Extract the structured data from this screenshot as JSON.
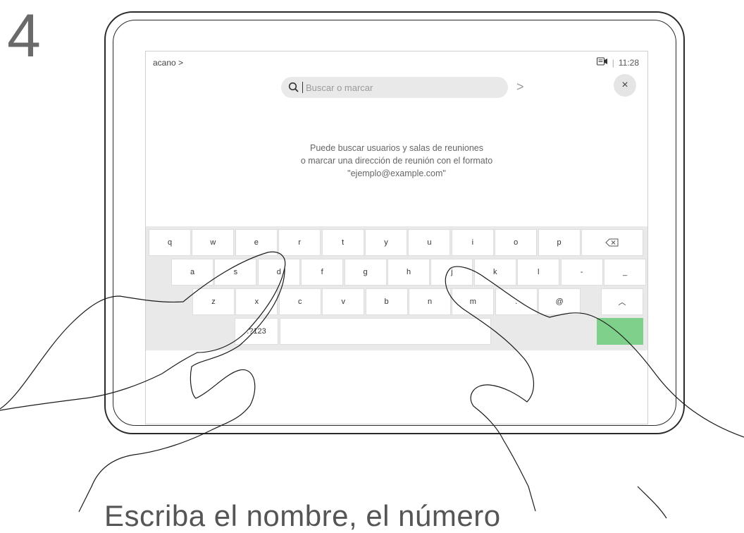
{
  "step": "4",
  "caption": "Escriba el nombre, el número",
  "topbar": {
    "left": "acano >",
    "time": "11:28",
    "separator": "|"
  },
  "search": {
    "placeholder": "Buscar o marcar",
    "go_symbol": ">"
  },
  "close_symbol": "×",
  "hint": {
    "line1": "Puede buscar usuarios y salas de reuniones",
    "line2": "o marcar una dirección de reunión con el formato",
    "line3": "\"ejemplo@example.com\""
  },
  "keyboard": {
    "row1": [
      "q",
      "w",
      "e",
      "r",
      "t",
      "y",
      "u",
      "i",
      "o",
      "p"
    ],
    "row2": [
      "a",
      "s",
      "d",
      "f",
      "g",
      "h",
      "j",
      "k",
      "l",
      "-",
      "_"
    ],
    "row3": [
      "z",
      "x",
      "c",
      "v",
      "b",
      "n",
      "m",
      ".",
      "@"
    ],
    "row4_left": ".?123",
    "shift_symbol": "︿"
  },
  "icons": {
    "search": "search-icon",
    "camera": "camera-icon",
    "close": "close-icon",
    "backspace": "backspace-icon",
    "shift": "shift-icon"
  },
  "colors": {
    "accent_green": "#7fd08a"
  }
}
